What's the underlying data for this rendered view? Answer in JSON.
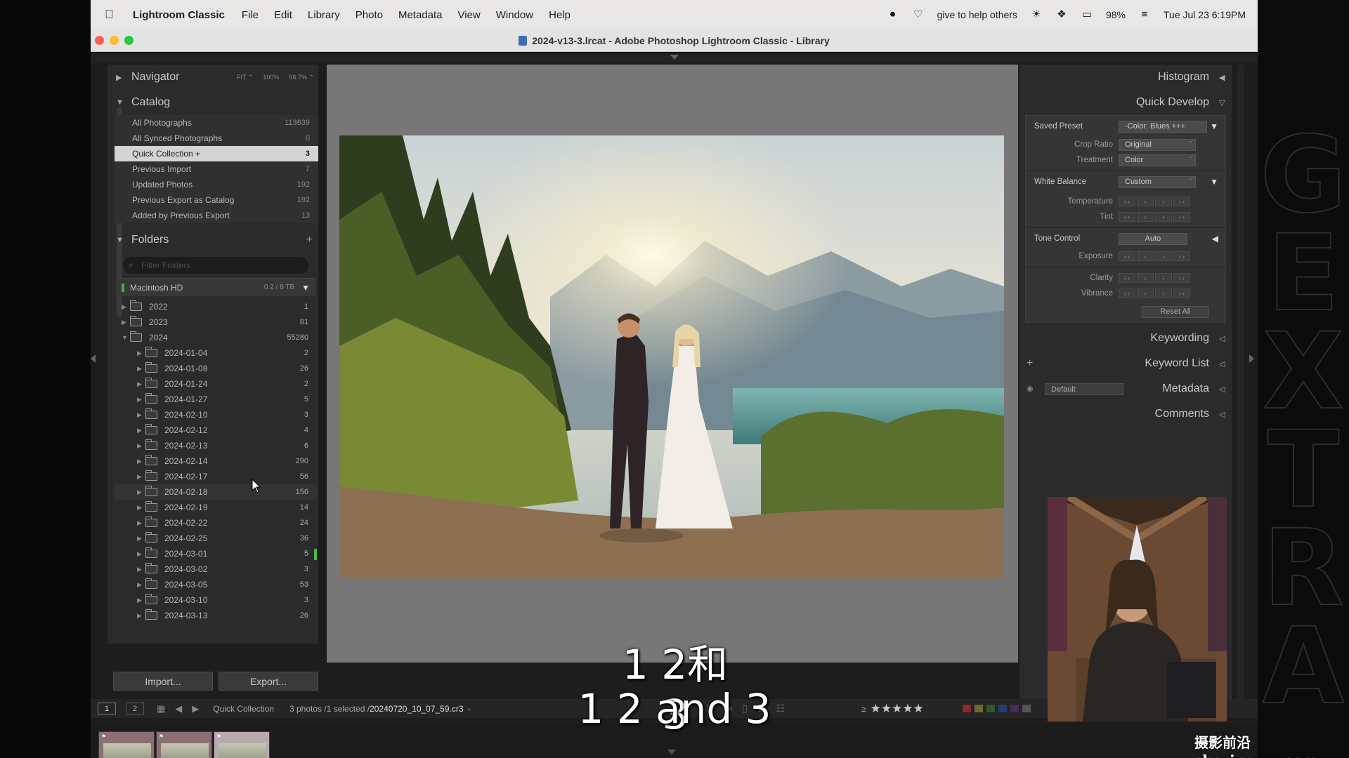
{
  "menubar": {
    "app_name": "Lightroom Classic",
    "menus": [
      "File",
      "Edit",
      "Library",
      "Photo",
      "Metadata",
      "View",
      "Window",
      "Help"
    ],
    "status_text": "give to help others",
    "battery": "98%",
    "clock": "Tue Jul 23  6:19PM"
  },
  "window": {
    "title": "2024-v13-3.lrcat - Adobe Photoshop Lightroom Classic - Library"
  },
  "navigator": {
    "label": "Navigator",
    "opts": [
      "FIT ⌃",
      "100%",
      "66.7% ⌃"
    ]
  },
  "catalog": {
    "label": "Catalog",
    "items": [
      {
        "label": "All Photographs",
        "count": "113639"
      },
      {
        "label": "All Synced Photographs",
        "count": "0"
      },
      {
        "label": "Quick Collection  +",
        "count": "3"
      },
      {
        "label": "Previous Import",
        "count": "7"
      },
      {
        "label": "Updated Photos",
        "count": "192"
      },
      {
        "label": "Previous Export as Catalog",
        "count": "192"
      },
      {
        "label": "Added by Previous Export",
        "count": "13"
      }
    ]
  },
  "folders": {
    "label": "Folders",
    "add": "+",
    "search_placeholder": "Filter Folders",
    "volume": {
      "name": "Macintosh HD",
      "size": "0.2 / 8 TB"
    },
    "top": [
      {
        "name": "2022",
        "count": "1",
        "twisty": "▶"
      },
      {
        "name": "2023",
        "count": "81",
        "twisty": "▶"
      },
      {
        "name": "2024",
        "count": "55280",
        "twisty": "▼"
      }
    ],
    "sub": [
      {
        "name": "2024-01-04",
        "count": "2"
      },
      {
        "name": "2024-01-08",
        "count": "26"
      },
      {
        "name": "2024-01-24",
        "count": "2"
      },
      {
        "name": "2024-01-27",
        "count": "5"
      },
      {
        "name": "2024-02-10",
        "count": "3"
      },
      {
        "name": "2024-02-12",
        "count": "4"
      },
      {
        "name": "2024-02-13",
        "count": "6"
      },
      {
        "name": "2024-02-14",
        "count": "290"
      },
      {
        "name": "2024-02-17",
        "count": "56"
      },
      {
        "name": "2024-02-18",
        "count": "156"
      },
      {
        "name": "2024-02-19",
        "count": "14"
      },
      {
        "name": "2024-02-22",
        "count": "24"
      },
      {
        "name": "2024-02-25",
        "count": "36"
      },
      {
        "name": "2024-03-01",
        "count": "5"
      },
      {
        "name": "2024-03-02",
        "count": "3"
      },
      {
        "name": "2024-03-05",
        "count": "53"
      },
      {
        "name": "2024-03-10",
        "count": "3"
      },
      {
        "name": "2024-03-13",
        "count": "26"
      }
    ]
  },
  "left_buttons": {
    "import": "Import...",
    "export": "Export..."
  },
  "right": {
    "histogram": "Histogram",
    "quick_develop": "Quick Develop",
    "saved_preset_label": "Saved Preset",
    "saved_preset_value": "-Color: Blues +++",
    "crop_ratio_label": "Crop Ratio",
    "crop_ratio_value": "Original",
    "treatment_label": "Treatment",
    "treatment_value": "Color",
    "white_balance_label": "White Balance",
    "white_balance_value": "Custom",
    "temperature_label": "Temperature",
    "tint_label": "Tint",
    "tone_control_label": "Tone Control",
    "auto_label": "Auto",
    "exposure_label": "Exposure",
    "clarity_label": "Clarity",
    "vibrance_label": "Vibrance",
    "reset_all": "Reset All",
    "keywording": "Keywording",
    "keyword_list": "Keyword List",
    "metadata": "Metadata",
    "metadata_preset": "Default",
    "comments": "Comments",
    "step_glyphs": [
      "‹ ‹",
      "‹",
      "›",
      "› ›"
    ]
  },
  "toolbar": {
    "view1": "1",
    "view2": "2",
    "source": "Quick Collection",
    "selection": "3 photos /1 selected /",
    "filename": "20240720_10_07_59.cr3",
    "rating_prefix": "≥",
    "stars": "★★★★★"
  },
  "filmstrip": {
    "thumbs": [
      {
        "stars": "★★",
        "selected": false
      },
      {
        "stars": "★★",
        "selected": false
      },
      {
        "stars": "★★",
        "selected": true
      }
    ]
  },
  "colors": {
    "label_red": "#8b2a2a",
    "label_yellow": "#6b6a2a",
    "label_green": "#2e5a2e",
    "label_blue": "#2a3a6b",
    "label_purple": "#4a2a5a",
    "label_gray": "#555555"
  },
  "subtitles": {
    "chinese": "1 2和3",
    "english": "1 2 and 3"
  },
  "watermarks": {
    "side_letters": [
      "G",
      "E",
      "X",
      "T",
      "R",
      "A"
    ],
    "site": "摄影前沿 sheyingzyz.com"
  }
}
